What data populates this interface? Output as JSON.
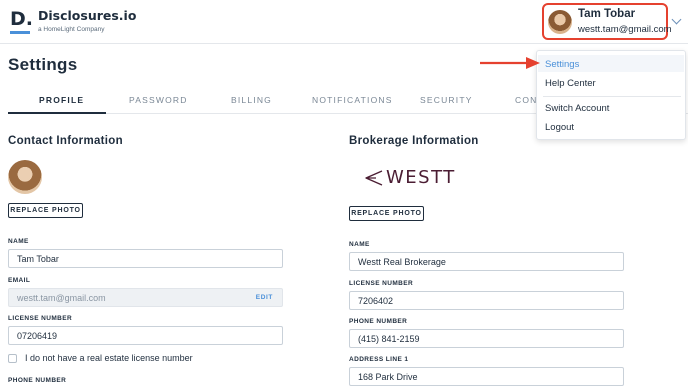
{
  "header": {
    "logo_mark": "D.",
    "logo_name": "Disclosures.io",
    "logo_subtitle": "a HomeLight Company",
    "user_name": "Tam Tobar",
    "user_email": "westt.tam@gmail.com"
  },
  "page_title": "Settings",
  "tabs": [
    {
      "label": "PROFILE"
    },
    {
      "label": "PASSWORD"
    },
    {
      "label": "BILLING"
    },
    {
      "label": "NOTIFICATIONS"
    },
    {
      "label": "SECURITY"
    },
    {
      "label": "CONT"
    }
  ],
  "contact": {
    "title": "Contact Information",
    "replace_photo": "REPLACE PHOTO",
    "name_label": "NAME",
    "name_value": "Tam Tobar",
    "email_label": "EMAIL",
    "email_value": "westt.tam@gmail.com",
    "edit_label": "EDIT",
    "license_label": "LICENSE NUMBER",
    "license_value": "07206419",
    "no_license_label": "I do not have a real estate license number",
    "phone_label": "PHONE NUMBER"
  },
  "brokerage": {
    "title": "Brokerage Information",
    "logo_text": "WESTT",
    "replace_photo": "REPLACE PHOTO",
    "name_label": "NAME",
    "name_value": "Westt Real Brokerage",
    "license_label": "LICENSE NUMBER",
    "license_value": "7206402",
    "phone_label": "PHONE NUMBER",
    "phone_value": "(415) 841-2159",
    "address_label": "ADDRESS LINE 1",
    "address_value": "168 Park Drive"
  },
  "menu": {
    "items": [
      {
        "label": "Settings"
      },
      {
        "label": "Help Center"
      },
      {
        "label": "Switch Account"
      },
      {
        "label": "Logout"
      }
    ]
  },
  "colors": {
    "accent": "#4a90d9",
    "highlight": "#e5412f",
    "text": "#1f2d3d"
  }
}
